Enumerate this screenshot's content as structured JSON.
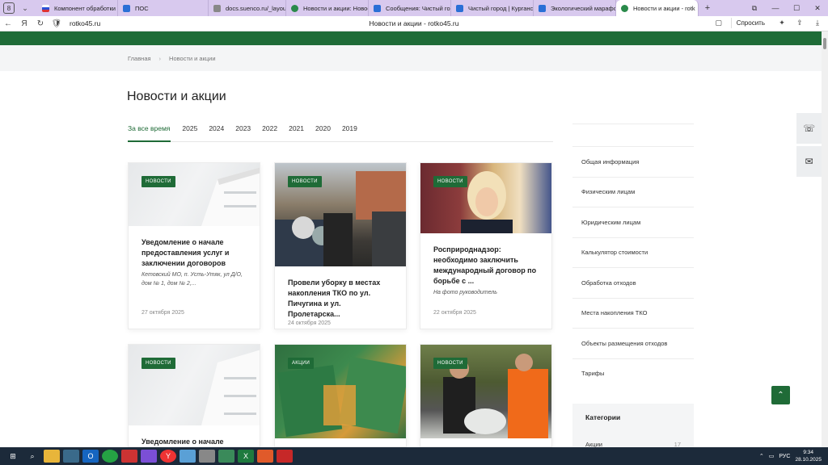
{
  "browser": {
    "tab_counter": "8",
    "tabs": [
      {
        "label": "Компонент обработки с",
        "color": "#d33"
      },
      {
        "label": "ПОС",
        "color": "#2a6fd6"
      },
      {
        "label": "docs.suenco.ru/_layouts/",
        "color": "#888"
      },
      {
        "label": "Новости и акции: Новос",
        "color": "#2a8a4a"
      },
      {
        "label": "Сообщения: Чистый гор",
        "color": "#2a6fd6"
      },
      {
        "label": "Чистый город | Курганс",
        "color": "#2a6fd6"
      },
      {
        "label": "Экологический марафо",
        "color": "#2a6fd6"
      },
      {
        "label": "Новости и акции - rotk",
        "color": "#2a8a4a"
      }
    ],
    "url": "rotko45.ru",
    "page_title": "Новости и акции - rotko45.ru",
    "ask_label": "Спросить"
  },
  "breadcrumb": {
    "home": "Главная",
    "current": "Новости и акции"
  },
  "page": {
    "title": "Новости и акции"
  },
  "filters": [
    "За все время",
    "2025",
    "2024",
    "2023",
    "2022",
    "2021",
    "2020",
    "2019"
  ],
  "cards": [
    {
      "badge": "Новости",
      "title": "Уведомление о начале предоставления услуг и заключении договоров",
      "excerpt": "Кетовский МО, п. Усть-Утяк, ул Д/О, дом № 1, дом № 2,...",
      "date": "27 октября 2025"
    },
    {
      "badge": "Новости",
      "title": "Провели уборку в местах накопления ТКО по ул. Пичугина и ул. Пролетарска...",
      "excerpt": "",
      "date": "24 октября 2025"
    },
    {
      "badge": "Новости",
      "title": "Росприроднадзор: необходимо заключить международный договор по борьбе с ...",
      "excerpt": "На фото руководитель",
      "date": "22 октября 2025"
    },
    {
      "badge": "Новости",
      "title": "Уведомление о начале",
      "excerpt": "",
      "date": ""
    },
    {
      "badge": "Акции",
      "title": "",
      "excerpt": "",
      "date": ""
    },
    {
      "badge": "Новости",
      "title": "",
      "excerpt": "",
      "date": ""
    }
  ],
  "sidebar": {
    "items": [
      "Общая информация",
      "Физическим лицам",
      "Юридическим лицам",
      "Калькулятор стоимости",
      "Обработка отходов",
      "Места накопления ТКО",
      "Объекты размещения отходов",
      "Тарифы"
    ],
    "categories_title": "Категории",
    "categories": [
      {
        "name": "Акции",
        "count": "17"
      }
    ]
  },
  "taskbar": {
    "lang": "РУС",
    "time": "9:34",
    "date": "28.10.2025"
  }
}
